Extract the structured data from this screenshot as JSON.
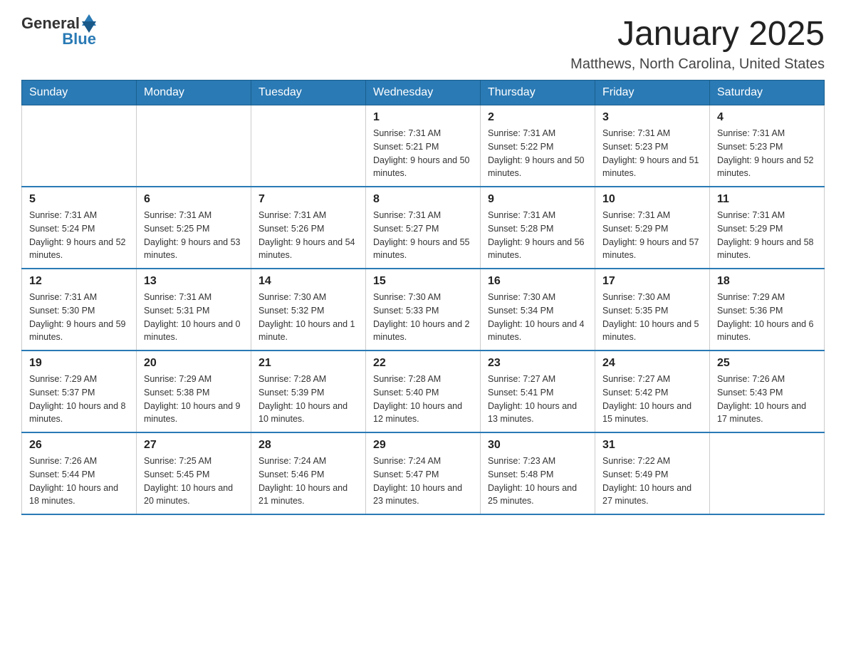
{
  "logo": {
    "text_general": "General",
    "text_blue": "Blue"
  },
  "calendar": {
    "title": "January 2025",
    "subtitle": "Matthews, North Carolina, United States",
    "days_of_week": [
      "Sunday",
      "Monday",
      "Tuesday",
      "Wednesday",
      "Thursday",
      "Friday",
      "Saturday"
    ],
    "weeks": [
      [
        {
          "day": "",
          "info": ""
        },
        {
          "day": "",
          "info": ""
        },
        {
          "day": "",
          "info": ""
        },
        {
          "day": "1",
          "info": "Sunrise: 7:31 AM\nSunset: 5:21 PM\nDaylight: 9 hours and 50 minutes."
        },
        {
          "day": "2",
          "info": "Sunrise: 7:31 AM\nSunset: 5:22 PM\nDaylight: 9 hours and 50 minutes."
        },
        {
          "day": "3",
          "info": "Sunrise: 7:31 AM\nSunset: 5:23 PM\nDaylight: 9 hours and 51 minutes."
        },
        {
          "day": "4",
          "info": "Sunrise: 7:31 AM\nSunset: 5:23 PM\nDaylight: 9 hours and 52 minutes."
        }
      ],
      [
        {
          "day": "5",
          "info": "Sunrise: 7:31 AM\nSunset: 5:24 PM\nDaylight: 9 hours and 52 minutes."
        },
        {
          "day": "6",
          "info": "Sunrise: 7:31 AM\nSunset: 5:25 PM\nDaylight: 9 hours and 53 minutes."
        },
        {
          "day": "7",
          "info": "Sunrise: 7:31 AM\nSunset: 5:26 PM\nDaylight: 9 hours and 54 minutes."
        },
        {
          "day": "8",
          "info": "Sunrise: 7:31 AM\nSunset: 5:27 PM\nDaylight: 9 hours and 55 minutes."
        },
        {
          "day": "9",
          "info": "Sunrise: 7:31 AM\nSunset: 5:28 PM\nDaylight: 9 hours and 56 minutes."
        },
        {
          "day": "10",
          "info": "Sunrise: 7:31 AM\nSunset: 5:29 PM\nDaylight: 9 hours and 57 minutes."
        },
        {
          "day": "11",
          "info": "Sunrise: 7:31 AM\nSunset: 5:29 PM\nDaylight: 9 hours and 58 minutes."
        }
      ],
      [
        {
          "day": "12",
          "info": "Sunrise: 7:31 AM\nSunset: 5:30 PM\nDaylight: 9 hours and 59 minutes."
        },
        {
          "day": "13",
          "info": "Sunrise: 7:31 AM\nSunset: 5:31 PM\nDaylight: 10 hours and 0 minutes."
        },
        {
          "day": "14",
          "info": "Sunrise: 7:30 AM\nSunset: 5:32 PM\nDaylight: 10 hours and 1 minute."
        },
        {
          "day": "15",
          "info": "Sunrise: 7:30 AM\nSunset: 5:33 PM\nDaylight: 10 hours and 2 minutes."
        },
        {
          "day": "16",
          "info": "Sunrise: 7:30 AM\nSunset: 5:34 PM\nDaylight: 10 hours and 4 minutes."
        },
        {
          "day": "17",
          "info": "Sunrise: 7:30 AM\nSunset: 5:35 PM\nDaylight: 10 hours and 5 minutes."
        },
        {
          "day": "18",
          "info": "Sunrise: 7:29 AM\nSunset: 5:36 PM\nDaylight: 10 hours and 6 minutes."
        }
      ],
      [
        {
          "day": "19",
          "info": "Sunrise: 7:29 AM\nSunset: 5:37 PM\nDaylight: 10 hours and 8 minutes."
        },
        {
          "day": "20",
          "info": "Sunrise: 7:29 AM\nSunset: 5:38 PM\nDaylight: 10 hours and 9 minutes."
        },
        {
          "day": "21",
          "info": "Sunrise: 7:28 AM\nSunset: 5:39 PM\nDaylight: 10 hours and 10 minutes."
        },
        {
          "day": "22",
          "info": "Sunrise: 7:28 AM\nSunset: 5:40 PM\nDaylight: 10 hours and 12 minutes."
        },
        {
          "day": "23",
          "info": "Sunrise: 7:27 AM\nSunset: 5:41 PM\nDaylight: 10 hours and 13 minutes."
        },
        {
          "day": "24",
          "info": "Sunrise: 7:27 AM\nSunset: 5:42 PM\nDaylight: 10 hours and 15 minutes."
        },
        {
          "day": "25",
          "info": "Sunrise: 7:26 AM\nSunset: 5:43 PM\nDaylight: 10 hours and 17 minutes."
        }
      ],
      [
        {
          "day": "26",
          "info": "Sunrise: 7:26 AM\nSunset: 5:44 PM\nDaylight: 10 hours and 18 minutes."
        },
        {
          "day": "27",
          "info": "Sunrise: 7:25 AM\nSunset: 5:45 PM\nDaylight: 10 hours and 20 minutes."
        },
        {
          "day": "28",
          "info": "Sunrise: 7:24 AM\nSunset: 5:46 PM\nDaylight: 10 hours and 21 minutes."
        },
        {
          "day": "29",
          "info": "Sunrise: 7:24 AM\nSunset: 5:47 PM\nDaylight: 10 hours and 23 minutes."
        },
        {
          "day": "30",
          "info": "Sunrise: 7:23 AM\nSunset: 5:48 PM\nDaylight: 10 hours and 25 minutes."
        },
        {
          "day": "31",
          "info": "Sunrise: 7:22 AM\nSunset: 5:49 PM\nDaylight: 10 hours and 27 minutes."
        },
        {
          "day": "",
          "info": ""
        }
      ]
    ]
  }
}
